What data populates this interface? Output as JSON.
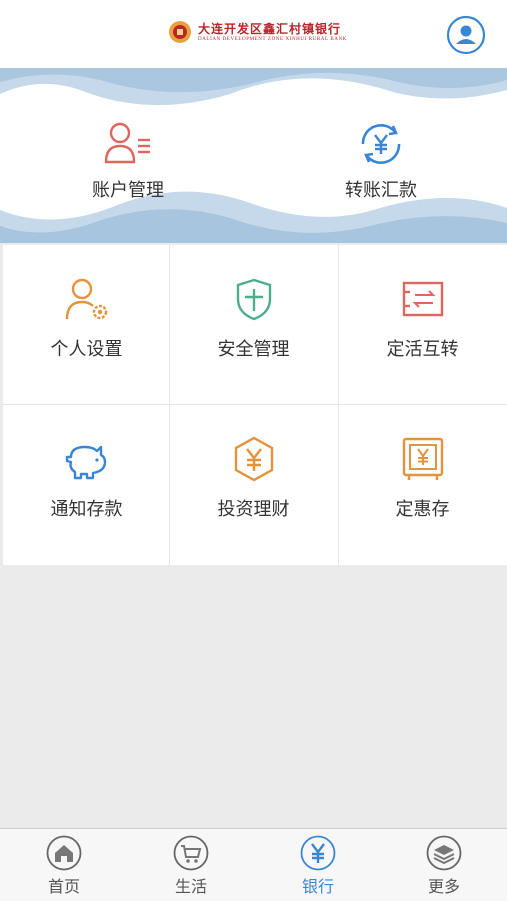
{
  "header": {
    "logo_cn": "大连开发区鑫汇村镇银行",
    "logo_en": "DALIAN DEVELOPMENT ZONE XINHUI RURAL BANK",
    "avatar_icon": "user-icon"
  },
  "banner": {
    "items": [
      {
        "label": "账户管理",
        "icon": "account-card-icon"
      },
      {
        "label": "转账汇款",
        "icon": "transfer-yuan-icon"
      }
    ]
  },
  "grid": {
    "items": [
      {
        "label": "个人设置",
        "icon": "user-settings-icon"
      },
      {
        "label": "安全管理",
        "icon": "shield-icon"
      },
      {
        "label": "定活互转",
        "icon": "exchange-icon"
      },
      {
        "label": "通知存款",
        "icon": "piggy-bank-icon"
      },
      {
        "label": "投资理财",
        "icon": "hexagon-yuan-icon"
      },
      {
        "label": "定惠存",
        "icon": "safe-icon"
      }
    ]
  },
  "tabbar": {
    "tabs": [
      {
        "label": "首页",
        "icon": "home-icon"
      },
      {
        "label": "生活",
        "icon": "cart-icon"
      },
      {
        "label": "银行",
        "icon": "yuan-icon",
        "active": true
      },
      {
        "label": "更多",
        "icon": "layers-icon"
      }
    ]
  },
  "colors": {
    "accent_blue": "#3a86d4",
    "logo_red": "#b8262b",
    "icon_red": "#e0655e",
    "icon_orange": "#e4923b",
    "icon_green": "#4cae8d"
  }
}
